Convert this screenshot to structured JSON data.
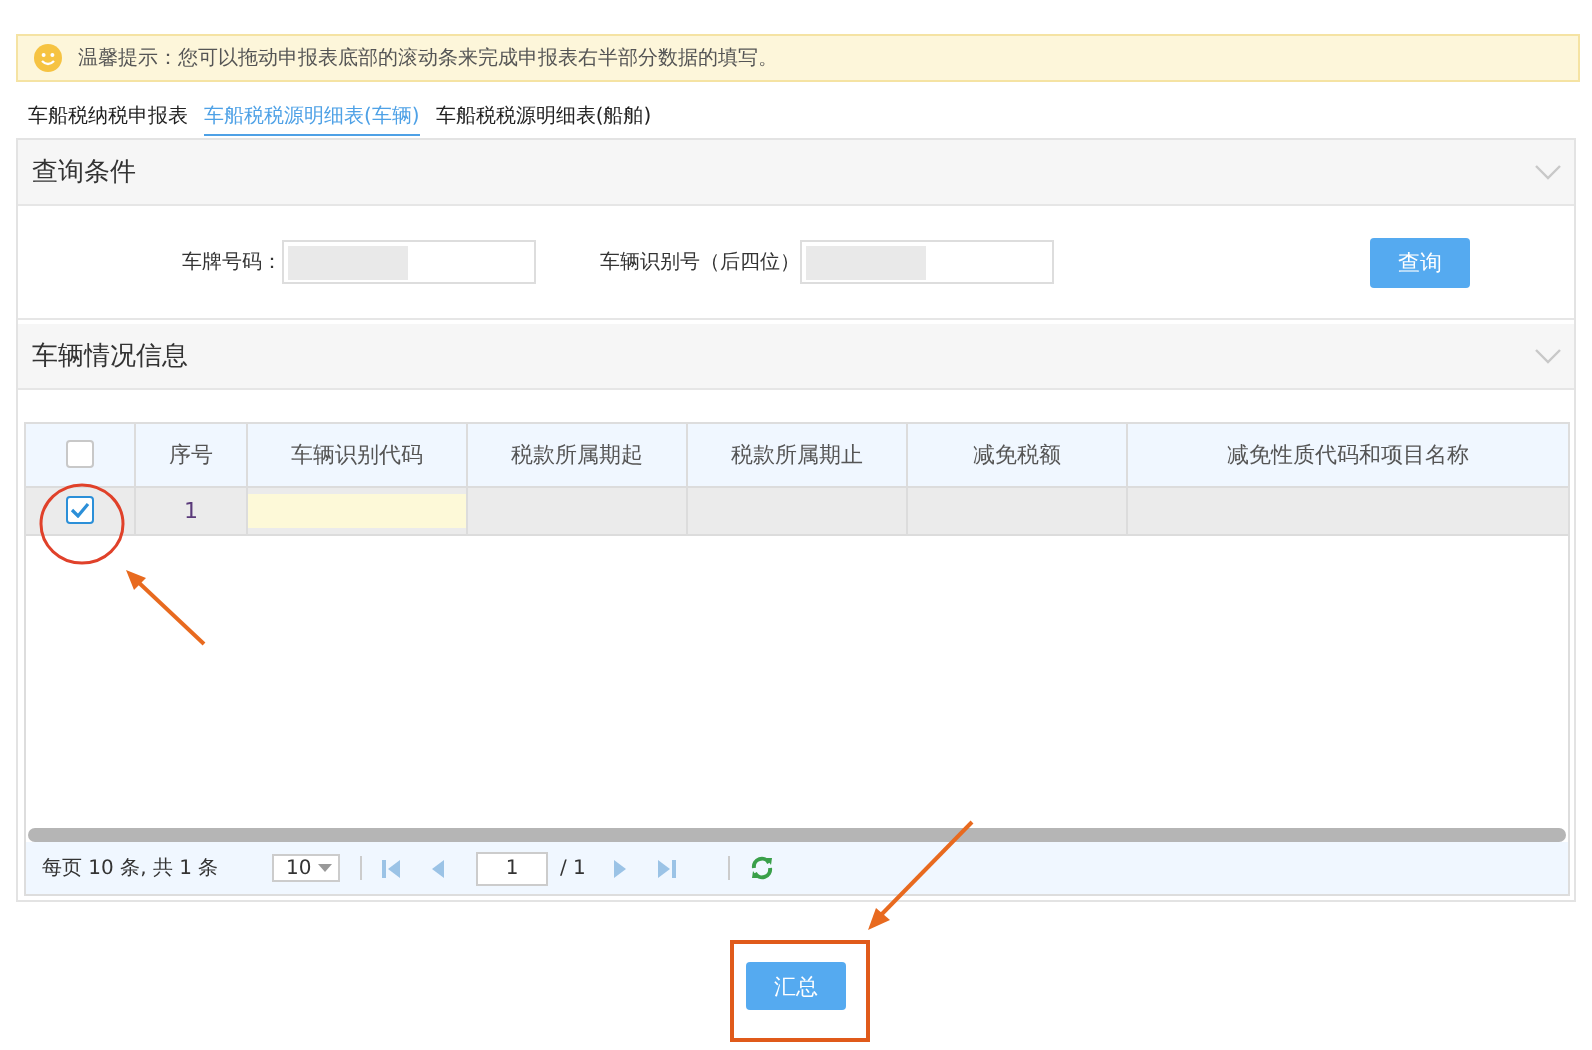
{
  "notice": {
    "text": "温馨提示：您可以拖动申报表底部的滚动条来完成申报表右半部分数据的填写。"
  },
  "tabs": [
    {
      "label": "车船税纳税申报表",
      "selected": false
    },
    {
      "label": "车船税税源明细表(车辆)",
      "selected": true
    },
    {
      "label": "车船税税源明细表(船舶)",
      "selected": false
    }
  ],
  "query_panel": {
    "title": "查询条件",
    "fields": [
      {
        "label": "车牌号码："
      },
      {
        "label": "车辆识别号（后四位）"
      }
    ],
    "button": "查询"
  },
  "vehicle_panel": {
    "title": "车辆情况信息",
    "header_checked": false,
    "columns": [
      "序号",
      "车辆识别代码",
      "税款所属期起",
      "税款所属期止",
      "减免税额",
      "减免性质代码和项目名称"
    ],
    "rows": [
      {
        "checked": true,
        "number": "1"
      }
    ]
  },
  "pager": {
    "summary": "每页 10 条, 共 1 条",
    "page_size": "10",
    "page": "1",
    "total": "/ 1"
  },
  "submit_button": "汇总"
}
